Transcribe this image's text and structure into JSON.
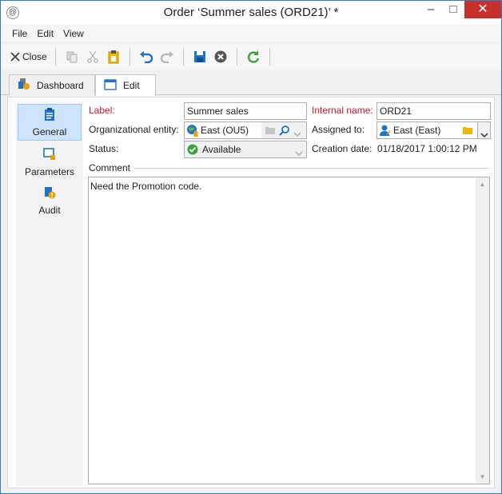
{
  "window": {
    "title": "Order  ‘Summer sales (ORD21)’ *",
    "app_icon_glyph": "@",
    "minimize_glyph": "–",
    "maximize_glyph": "□",
    "close_glyph": "✕"
  },
  "menu": {
    "items": [
      "File",
      "Edit",
      "View"
    ]
  },
  "toolbar": {
    "close_label": "Close"
  },
  "tabs": [
    {
      "label": "Dashboard",
      "icon": "dashboard-icon",
      "active": false
    },
    {
      "label": "Edit",
      "icon": "edit-window-icon",
      "active": true
    }
  ],
  "sidenav": [
    {
      "label": "General",
      "icon": "clipboard-icon",
      "active": true
    },
    {
      "label": "Parameters",
      "icon": "parameters-icon",
      "active": false
    },
    {
      "label": "Audit",
      "icon": "audit-icon",
      "active": false
    }
  ],
  "form": {
    "label_label": "Label:",
    "label_value": "Summer sales",
    "internal_name_label": "Internal name:",
    "internal_name_value": "ORD21",
    "org_entity_label": "Organizational entity:",
    "org_entity_value": "East (OU5)",
    "assigned_to_label": "Assigned to:",
    "assigned_to_value": "East (East)",
    "status_label": "Status:",
    "status_value": "Available",
    "creation_date_label": "Creation date:",
    "creation_date_value": "01/18/2017 1:00:12 PM",
    "comment_label": "Comment",
    "comment_value": "Need the Promotion code."
  },
  "colors": {
    "required_label": "#c0172a",
    "accent_blue": "#1e73c8",
    "close_button": "#c7302b",
    "status_green": "#3aa23a"
  }
}
